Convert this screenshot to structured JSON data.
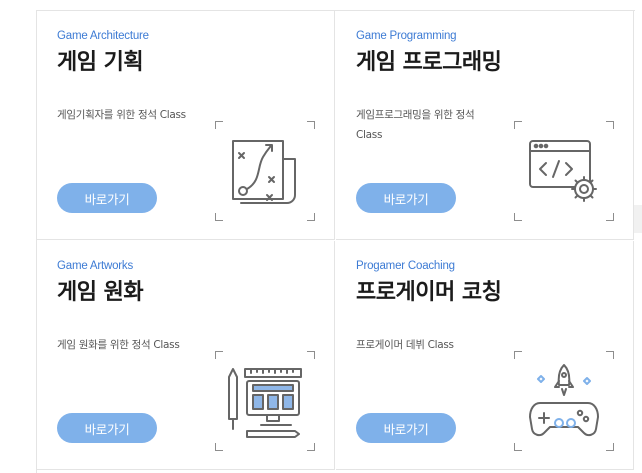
{
  "cards": [
    {
      "subtitle": "Game Architecture",
      "title": "게임 기획",
      "desc": "게임기획자를 위한 정석 Class",
      "button": "바로가기",
      "icon": "game-plan-icon"
    },
    {
      "subtitle": "Game Programming",
      "title": "게임 프로그래밍",
      "desc": "게임프로그래밍을 위한 정석 Class",
      "button": "바로가기",
      "icon": "code-gear-icon"
    },
    {
      "subtitle": "Game Artworks",
      "title": "게임 원화",
      "desc": "게임 원화를 위한 정석 Class",
      "button": "바로가기",
      "icon": "design-tools-icon"
    },
    {
      "subtitle": "Progamer Coaching",
      "title": "프로게이머 코칭",
      "desc": "프로게이머 데뷔 Class",
      "button": "바로가기",
      "icon": "gamepad-rocket-icon"
    }
  ],
  "colors": {
    "accent": "#3d7bd4",
    "button": "#7fb1ea",
    "icon_stroke": "#666666"
  }
}
